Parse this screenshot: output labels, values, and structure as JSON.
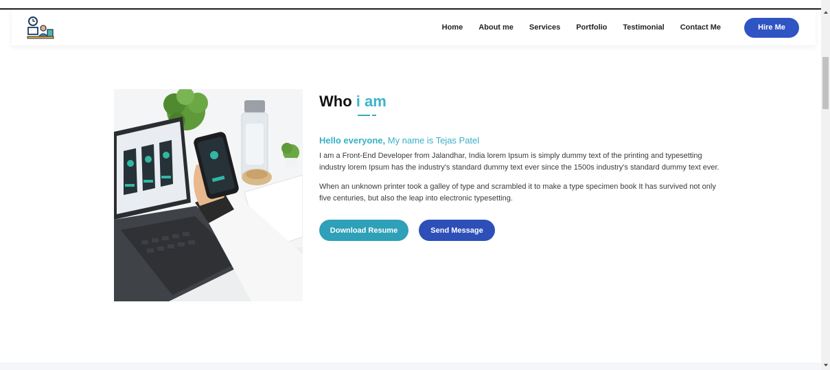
{
  "nav": {
    "logo_icon": "developer-clock-logo-icon",
    "links": [
      "Home",
      "About me",
      "Services",
      "Portfolio",
      "Testimonial",
      "Contact Me"
    ],
    "hire_label": "Hire Me"
  },
  "about": {
    "heading_main": "Who",
    "heading_accent": "i am",
    "greeting_strong": "Hello everyone,",
    "greeting_rest": "My name is Tejas Patel",
    "paragraph1": "I am a Front-End Developer from Jalandhar, India lorem Ipsum is simply dummy text of the printing and typesetting industry lorem Ipsum has the industry's standard dummy text ever since the 1500s industry's standard dummy text ever.",
    "paragraph2": "When an unknown printer took a galley of type and scrambled it to make a type specimen book It has survived not only five centuries, but also the leap into electronic typesetting.",
    "download_label": "Download Resume",
    "send_label": "Send Message"
  },
  "colors": {
    "accent": "#3bb3c8",
    "primary": "#2f54c4",
    "teal_button": "#2ea0b8"
  }
}
